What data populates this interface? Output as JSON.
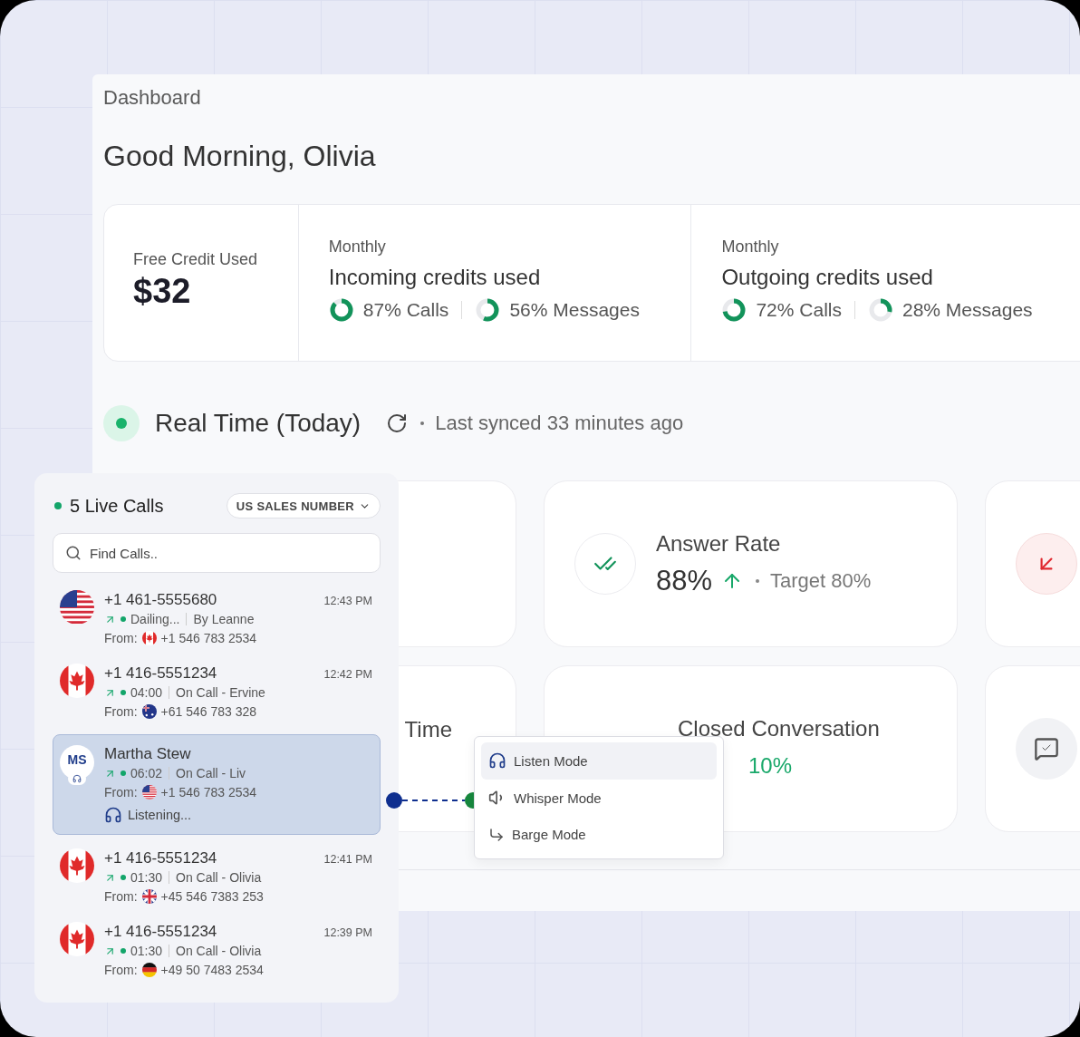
{
  "dashboard": {
    "breadcrumb": "Dashboard",
    "greeting": "Good Morning, Olivia",
    "free_credit": {
      "label": "Free Credit Used",
      "value": "$32"
    },
    "credit_groups": [
      {
        "period": "Monthly",
        "title": "Incoming credits used",
        "meters": [
          {
            "label": "87% Calls",
            "level": 0.87
          },
          {
            "label": "56% Messages",
            "level": 0.56
          }
        ]
      },
      {
        "period": "Monthly",
        "title": "Outgoing credits used",
        "meters": [
          {
            "label": "72% Calls",
            "level": 0.72
          },
          {
            "label": "28% Messages",
            "level": 0.28
          }
        ]
      }
    ],
    "realtime": {
      "title": "Real Time (Today)",
      "synced": "Last synced 33 minutes ago"
    },
    "cards": [
      {
        "kind": "blank"
      },
      {
        "kind": "metric",
        "title": "Answer Rate",
        "value": "88%",
        "target": "Target 80%"
      },
      {
        "kind": "icon"
      },
      {
        "kind": "text",
        "title": "Time"
      },
      {
        "kind": "metric",
        "title": "Closed Conversation",
        "change": "10%"
      },
      {
        "kind": "icon"
      }
    ]
  },
  "live_calls": {
    "title": "5 Live Calls",
    "number_filter": "US SALES NUMBER",
    "search": {
      "placeholder": "Find Calls.."
    },
    "calls": [
      {
        "caller": "+1 461-5555680",
        "time": "12:43 PM",
        "status": "Dailing...",
        "agent": "By Leanne",
        "from_label": "From:",
        "from_number": "+1 546 783 2534",
        "selected": false
      },
      {
        "caller": "+1 416-5551234",
        "time": "12:42 PM",
        "status": "04:00",
        "agent": "On Call - Ervine",
        "from_label": "From:",
        "from_number": "+61 546 783 328",
        "selected": false
      },
      {
        "initials": "MS",
        "caller": "Martha Stew",
        "status": "06:02",
        "agent": "On Call - Liv",
        "from_label": "From:",
        "from_number": "+1 546 783 2534",
        "listening": "Listening...",
        "selected": true
      },
      {
        "caller": "+1 416-5551234",
        "time": "12:41 PM",
        "status": "01:30",
        "agent": "On Call - Olivia",
        "from_label": "From:",
        "from_number": "+45 546 7383 253",
        "selected": false
      },
      {
        "caller": "+1 416-5551234",
        "time": "12:39 PM",
        "status": "01:30",
        "agent": "On Call - Olivia",
        "from_label": "From:",
        "from_number": "+49 50 7483 2534",
        "selected": false
      }
    ]
  },
  "mode_menu": {
    "items": [
      {
        "label": "Listen Mode",
        "selected": true
      },
      {
        "label": "Whisper Mode",
        "selected": false
      },
      {
        "label": "Barge Mode",
        "selected": false
      }
    ]
  }
}
